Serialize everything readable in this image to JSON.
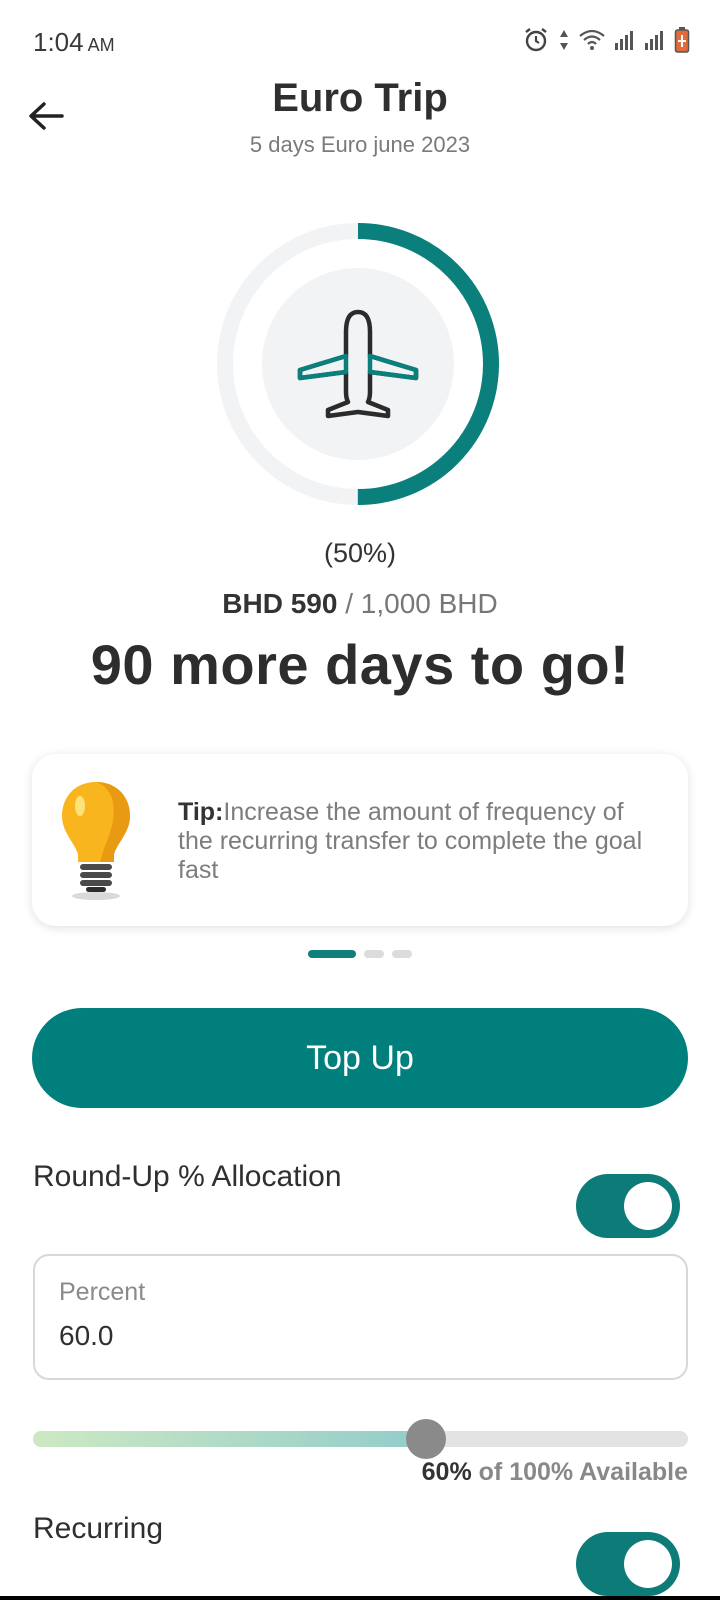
{
  "status_bar": {
    "time": "1:04",
    "ampm": "AM",
    "icons": [
      "alarm-icon",
      "data-arrows-icon",
      "wifi-icon",
      "signal-icon",
      "signal-icon",
      "battery-icon"
    ]
  },
  "header": {
    "title": "Euro Trip",
    "subtitle": "5 days Euro june 2023"
  },
  "goal": {
    "progress_fraction": 0.5,
    "percent_text": "(50%)",
    "saved": "BHD 590",
    "separator": "/",
    "target": "1,000 BHD",
    "days_left": "90 more days to go!",
    "icon": "airplane-icon"
  },
  "tip": {
    "label": "Tip:",
    "text": "Increase the amount of frequency of the recurring transfer to complete the goal fast",
    "icon": "lightbulb-icon",
    "page_count": 3,
    "active_page": 0
  },
  "actions": {
    "topup_label": "Top Up"
  },
  "roundup": {
    "label": "Round-Up % Allocation",
    "enabled": true,
    "field_label": "Percent",
    "field_value": "60.0",
    "slider_fraction": 0.6,
    "available_value": "60%",
    "available_text": " of 100% Available"
  },
  "recurring": {
    "label": "Recurring",
    "enabled": true
  },
  "colors": {
    "accent": "#007f7c",
    "ring_bg": "#f2f3f5",
    "bulb": "#f9b51d"
  }
}
